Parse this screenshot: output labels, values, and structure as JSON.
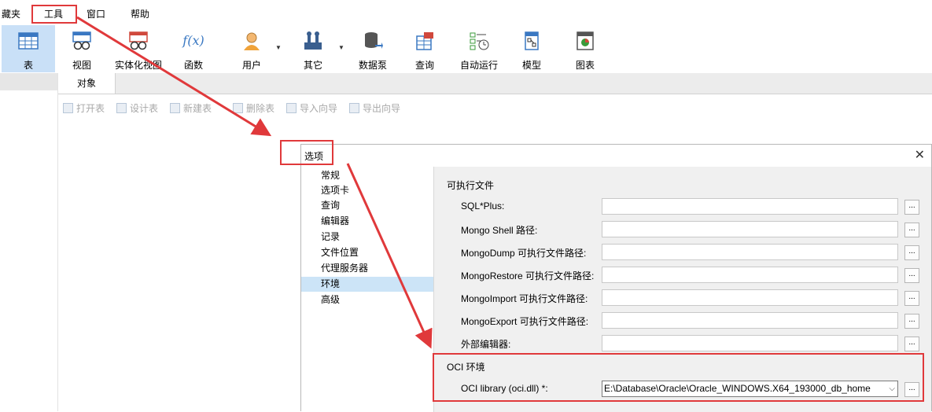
{
  "menubar": {
    "items": [
      "藏夹",
      "工具",
      "窗口",
      "帮助"
    ]
  },
  "toolbar": {
    "items": [
      {
        "label": "表",
        "icon": "table-icon"
      },
      {
        "label": "视图",
        "icon": "view-icon"
      },
      {
        "label": "实体化视图",
        "icon": "materialized-view-icon"
      },
      {
        "label": "函数",
        "icon": "function-icon"
      },
      {
        "label": "用户",
        "icon": "user-icon"
      },
      {
        "label": "其它",
        "icon": "tools-icon"
      },
      {
        "label": "数据泵",
        "icon": "datapump-icon"
      },
      {
        "label": "查询",
        "icon": "query-icon"
      },
      {
        "label": "自动运行",
        "icon": "autorun-icon"
      },
      {
        "label": "模型",
        "icon": "model-icon"
      },
      {
        "label": "图表",
        "icon": "chart-icon"
      }
    ],
    "function_glyph": "f(x)"
  },
  "tabs": {
    "objects": "对象"
  },
  "object_toolbar": [
    "打开表",
    "设计表",
    "新建表",
    "删除表",
    "导入向导",
    "导出向导"
  ],
  "dialog": {
    "title": "选项",
    "close": "✕",
    "nav": [
      "常规",
      "选项卡",
      "查询",
      "编辑器",
      "记录",
      "文件位置",
      "代理服务器",
      "环境",
      "高级"
    ],
    "selected_nav": "环境",
    "section_exe": "可执行文件",
    "fields": [
      {
        "label": "SQL*Plus:",
        "value": ""
      },
      {
        "label": "Mongo Shell 路径:",
        "value": ""
      },
      {
        "label": "MongoDump 可执行文件路径:",
        "value": ""
      },
      {
        "label": "MongoRestore 可执行文件路径:",
        "value": ""
      },
      {
        "label": "MongoImport 可执行文件路径:",
        "value": ""
      },
      {
        "label": "MongoExport 可执行文件路径:",
        "value": ""
      },
      {
        "label": "外部编辑器:",
        "value": ""
      }
    ],
    "browse": "...",
    "section_oci": "OCI 环境",
    "oci_label": "OCI library (oci.dll) *:",
    "oci_value": "E:\\Database\\Oracle\\Oracle_WINDOWS.X64_193000_db_home"
  },
  "colors": {
    "highlight": "#e0393b",
    "selected": "#cce4f7",
    "tool_active": "#c9e0f7"
  }
}
